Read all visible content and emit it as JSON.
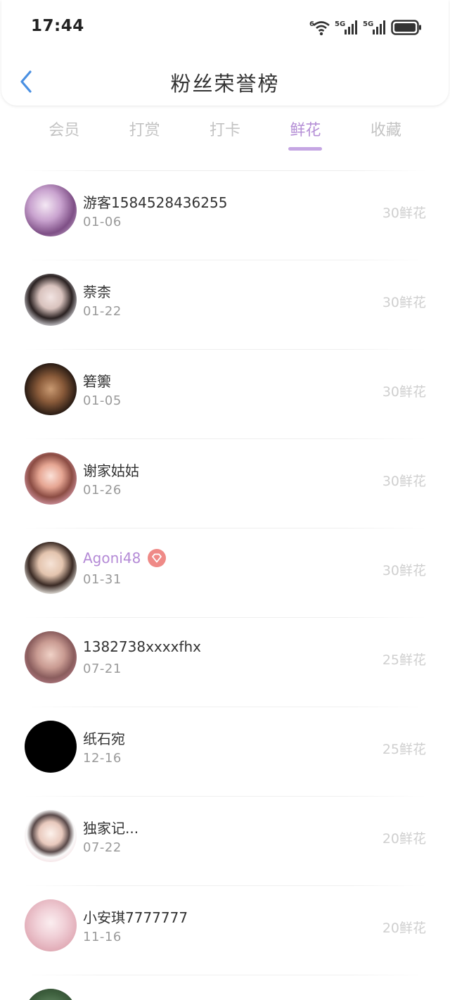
{
  "status_bar": {
    "time": "17:44",
    "wifi_label": "6",
    "signal1_label": "5G",
    "signal2_label": "5G"
  },
  "header": {
    "title": "粉丝荣誉榜"
  },
  "tabs": [
    {
      "label": "会员"
    },
    {
      "label": "打赏"
    },
    {
      "label": "打卡"
    },
    {
      "label": "鲜花",
      "active": true
    },
    {
      "label": "收藏"
    }
  ],
  "fans": [
    {
      "name": "游客1584528436255",
      "date": "01-06",
      "amount": "30鲜花",
      "vip": false
    },
    {
      "name": "萘柰",
      "date": "01-22",
      "amount": "30鲜花",
      "vip": false
    },
    {
      "name": "箬籞",
      "date": "01-05",
      "amount": "30鲜花",
      "vip": false
    },
    {
      "name": "谢家姑姑",
      "date": "01-26",
      "amount": "30鲜花",
      "vip": false
    },
    {
      "name": "Agoni48",
      "date": "01-31",
      "amount": "30鲜花",
      "vip": true
    },
    {
      "name": "1382738xxxxfhx",
      "date": "07-21",
      "amount": "25鲜花",
      "vip": false
    },
    {
      "name": "纸石宛",
      "date": "12-16",
      "amount": "25鲜花",
      "vip": false
    },
    {
      "name": "独家记...",
      "date": "07-22",
      "amount": "20鲜花",
      "vip": false
    },
    {
      "name": "小安琪7777777",
      "date": "11-16",
      "amount": "20鲜花",
      "vip": false
    }
  ],
  "colors": {
    "accent": "#b58fd6",
    "badge": "#ef8a87",
    "muted": "#cfcfcf"
  }
}
